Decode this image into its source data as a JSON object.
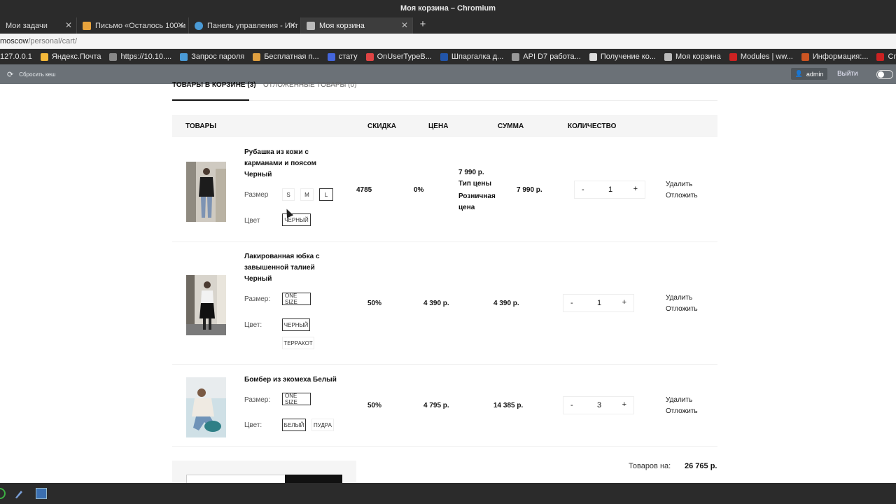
{
  "window": {
    "title": "Моя корзина – Chromium"
  },
  "tabs": [
    {
      "label": "Мои задачи",
      "icon": "task-icon",
      "color": "#4a4a4a"
    },
    {
      "label": "Письмо «Осталось 100 м",
      "icon": "mail-icon",
      "color": "#e8a33c"
    },
    {
      "label": "Панель управления - Инт",
      "icon": "gear-icon",
      "color": "#4a9ad6"
    },
    {
      "label": "Моя корзина",
      "icon": "cart-icon",
      "color": "#bbbbbb",
      "active": true
    }
  ],
  "address": {
    "url_main": "moscow",
    "url_path": "/personal/cart/"
  },
  "bookmarks": [
    {
      "label": "127.0.0.1",
      "color": "#777777"
    },
    {
      "label": "Яндекс.Почта",
      "color": "#f5b93a"
    },
    {
      "label": "https://10.10....",
      "color": "#888888"
    },
    {
      "label": "Запрос пароля",
      "color": "#4a9ad6"
    },
    {
      "label": "Бесплатная п...",
      "color": "#e0a040"
    },
    {
      "label": "стату",
      "color": "#4466dd"
    },
    {
      "label": "OnUserTypeB...",
      "color": "#e04444"
    },
    {
      "label": "Шпаргалка д...",
      "color": "#2255aa"
    },
    {
      "label": "API D7 работа...",
      "color": "#999999"
    },
    {
      "label": "Получение ко...",
      "color": "#dddddd"
    },
    {
      "label": "Моя корзина",
      "color": "#bbbbbb"
    },
    {
      "label": "Modules | ww...",
      "color": "#cc2222"
    },
    {
      "label": "Информация:...",
      "color": "#cc5522"
    },
    {
      "label": "Список товар",
      "color": "#cc2222"
    }
  ],
  "adminbar": {
    "cache_label": "Сбросить кеш",
    "user_label": "admin",
    "logout_label": "Выйти"
  },
  "cart_tabs": {
    "in_cart": "ТОВАРЫ В КОРЗИНЕ (3)",
    "deferred": "ОТЛОЖЕННЫЕ ТОВАРЫ (0)"
  },
  "table_headers": {
    "goods": "ТОВАРЫ",
    "discount": "СКИДКА",
    "price": "ЦЕНА",
    "sum": "СУММА",
    "quantity": "КОЛИЧЕСТВО"
  },
  "items": [
    {
      "name": "Рубашка из кожи с карманами и поясом Черный",
      "size_label": "Размер",
      "sizes": [
        "S",
        "M",
        "L"
      ],
      "selected_size": "L",
      "color_label": "Цвет",
      "colors": [
        "ЧЕРНЫЙ"
      ],
      "selected_color": "ЧЕРНЫЙ",
      "extra": "4785",
      "discount": "0%",
      "price": "7 990 р.",
      "price_type_label": "Тип цены",
      "price_type_value": "Розничная цена",
      "sum": "7 990 р.",
      "qty": "1"
    },
    {
      "name": "Лакированная юбка с завышенной талией Черный",
      "size_label": "Размер:",
      "sizes": [
        "ONE SIZE"
      ],
      "selected_size": "ONE SIZE",
      "color_label": "Цвет:",
      "colors": [
        "ЧЕРНЫЙ",
        "ТЕРРАКОТ"
      ],
      "selected_color": "ЧЕРНЫЙ",
      "discount": "50%",
      "price": "4 390 р.",
      "sum": "4 390 р.",
      "qty": "1"
    },
    {
      "name": "Бомбер из экомеха Белый",
      "size_label": "Размер:",
      "sizes": [
        "ONE SIZE"
      ],
      "selected_size": "ONE SIZE",
      "color_label": "Цвет:",
      "colors": [
        "БЕЛЫЙ",
        "ПУДРА"
      ],
      "selected_color": "БЕЛЫЙ",
      "discount": "50%",
      "price": "4 795 р.",
      "sum": "14 385 р.",
      "qty": "3"
    }
  ],
  "actions": {
    "delete": "Удалить",
    "defer": "Отложить"
  },
  "stepper": {
    "minus": "-",
    "plus": "+"
  },
  "summary": {
    "label": "Товаров на:",
    "value": "26 765 р."
  },
  "colors": {
    "admin_bar": "#6b7177",
    "chrome_dark": "#2b2b2b",
    "table_head": "#f5f5f5"
  }
}
